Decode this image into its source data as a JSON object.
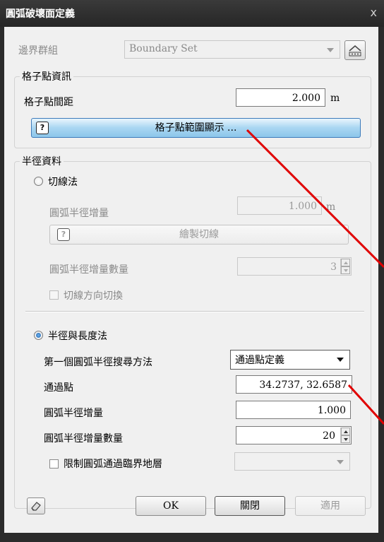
{
  "window": {
    "title": "圓弧破壞面定義",
    "close_glyph": "x"
  },
  "boundary": {
    "label": "邊界群組",
    "value": "Boundary Set",
    "icon": "boundary-set-icon"
  },
  "grid_info": {
    "legend": "格子點資訊",
    "spacing_label": "格子點間距",
    "spacing_value": "2.000",
    "spacing_unit": "m",
    "range_button_label": "格子點範圍顯示 ..."
  },
  "radius_info": {
    "legend": "半徑資料",
    "tangent": {
      "label": "切線法",
      "selected": false,
      "increment_label": "圓弧半徑增量",
      "increment_value": "1.000",
      "increment_unit": "m",
      "draw_button_label": "繪製切線",
      "count_label": "圓弧半徑增量數量",
      "count_value": "3",
      "toggle_label": "切線方向切換"
    },
    "radius_length": {
      "label": "半徑與長度法",
      "selected": true,
      "search_method_label": "第一個圓弧半徑搜尋方法",
      "search_method_value": "通過點定義",
      "pass_point_label": "通過點",
      "pass_point_value": "34.2737, 32.6587",
      "increment_label": "圓弧半徑增量",
      "increment_value": "1.000",
      "count_label": "圓弧半徑增量數量",
      "count_value": "20",
      "limit_label": "限制圓弧通過臨界地層",
      "limit_checked": false
    }
  },
  "footer": {
    "ok_label": "OK",
    "close_label": "關閉",
    "apply_label": "適用",
    "eraser_icon": "eraser-icon"
  },
  "colors": {
    "annotation_arrow": "#e00000",
    "highlight_button": "#9fd0ef"
  }
}
